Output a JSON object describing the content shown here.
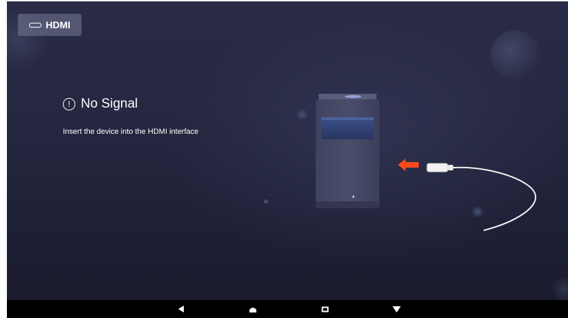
{
  "source_chip": {
    "label": "HDMI",
    "icon": "hdmi-port-icon"
  },
  "status": {
    "title": "No Signal",
    "icon": "alert-circle-icon",
    "message": "Insert the device into the HDMI interface"
  },
  "illustration": {
    "device": "device-icon",
    "arrow": "arrow-left-icon",
    "cable": "hdmi-cable-icon",
    "arrow_color": "#ff4a1c"
  },
  "nav_bar": {
    "buttons": [
      {
        "name": "back",
        "icon": "back-triangle-icon"
      },
      {
        "name": "home",
        "icon": "home-icon"
      },
      {
        "name": "recents",
        "icon": "recents-icon"
      },
      {
        "name": "menu",
        "icon": "down-triangle-icon"
      }
    ]
  },
  "colors": {
    "background_top": "#2a2c47",
    "background_bottom": "#1a1b2e",
    "text": "#ffffff",
    "nav_bar": "#000000"
  }
}
